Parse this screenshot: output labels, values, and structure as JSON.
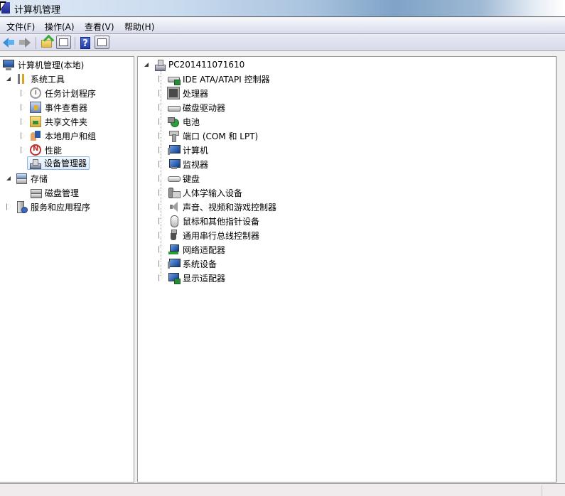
{
  "window": {
    "title": "计算机管理"
  },
  "menubar": {
    "items": [
      {
        "label": "文件(F)"
      },
      {
        "label": "操作(A)"
      },
      {
        "label": "查看(V)"
      },
      {
        "label": "帮助(H)"
      }
    ]
  },
  "toolbar": {
    "buttons": [
      {
        "name": "back",
        "icon": "back-arrow-icon"
      },
      {
        "name": "forward",
        "icon": "forward-arrow-icon"
      },
      {
        "name": "up-one-level",
        "icon": "folder-up-icon"
      },
      {
        "name": "show-hide-console-tree",
        "icon": "console-tree-icon"
      },
      {
        "name": "help",
        "icon": "help-icon",
        "glyph": "?"
      },
      {
        "name": "show-hide-action-pane",
        "icon": "action-pane-icon"
      }
    ]
  },
  "left_tree": {
    "root": {
      "label": "计算机管理(本地)",
      "icon": "computer-management-icon"
    },
    "items": [
      {
        "label": "系统工具",
        "icon": "tools-icon",
        "level": 1,
        "state": "expanded"
      },
      {
        "label": "任务计划程序",
        "icon": "clock-icon",
        "level": 2,
        "state": "collapsed"
      },
      {
        "label": "事件查看器",
        "icon": "event-viewer-icon",
        "level": 2,
        "state": "collapsed"
      },
      {
        "label": "共享文件夹",
        "icon": "shared-folder-icon",
        "level": 2,
        "state": "collapsed"
      },
      {
        "label": "本地用户和组",
        "icon": "users-icon",
        "level": 2,
        "state": "collapsed"
      },
      {
        "label": "性能",
        "icon": "performance-icon",
        "level": 2,
        "state": "collapsed"
      },
      {
        "label": "设备管理器",
        "icon": "device-manager-icon",
        "level": 2,
        "state": "leaf",
        "selected": true
      },
      {
        "label": "存储",
        "icon": "storage-icon",
        "level": 1,
        "state": "expanded"
      },
      {
        "label": "磁盘管理",
        "icon": "disk-management-icon",
        "level": 2,
        "state": "leaf"
      },
      {
        "label": "服务和应用程序",
        "icon": "services-icon",
        "level": 1,
        "state": "collapsed"
      }
    ]
  },
  "device_tree": {
    "root": {
      "label": "PC201411071610",
      "icon": "pc-icon"
    },
    "items": [
      {
        "label": "IDE ATA/ATAPI 控制器",
        "icon": "ide-controller-icon"
      },
      {
        "label": "处理器",
        "icon": "processor-icon"
      },
      {
        "label": "磁盘驱动器",
        "icon": "disk-drive-icon"
      },
      {
        "label": "电池",
        "icon": "battery-icon"
      },
      {
        "label": "端口 (COM 和 LPT)",
        "icon": "port-icon"
      },
      {
        "label": "计算机",
        "icon": "computer-icon"
      },
      {
        "label": "监视器",
        "icon": "monitor-icon"
      },
      {
        "label": "键盘",
        "icon": "keyboard-icon"
      },
      {
        "label": "人体学输入设备",
        "icon": "hid-icon"
      },
      {
        "label": "声音、视频和游戏控制器",
        "icon": "sound-icon"
      },
      {
        "label": "鼠标和其他指针设备",
        "icon": "mouse-icon"
      },
      {
        "label": "通用串行总线控制器",
        "icon": "usb-icon"
      },
      {
        "label": "网络适配器",
        "icon": "network-adapter-icon"
      },
      {
        "label": "系统设备",
        "icon": "system-device-icon"
      },
      {
        "label": "显示适配器",
        "icon": "display-adapter-icon"
      }
    ]
  }
}
